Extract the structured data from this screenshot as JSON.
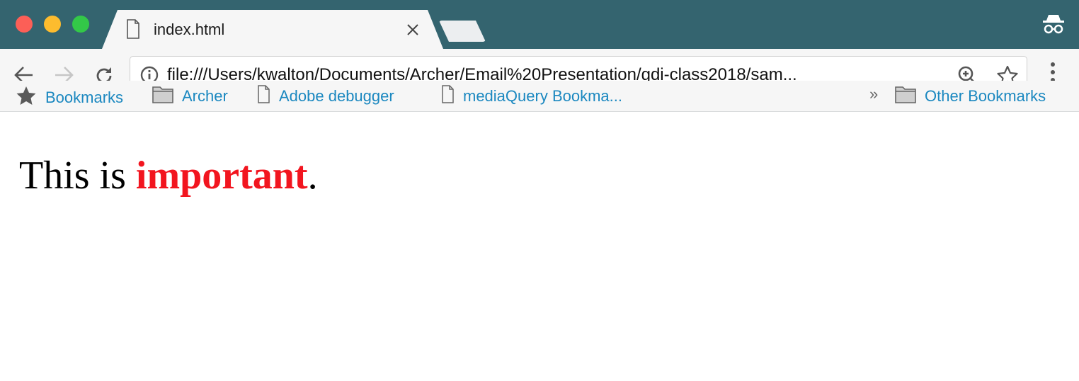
{
  "tab": {
    "title": "index.html"
  },
  "address_bar": {
    "url": "file:///Users/kwalton/Documents/Archer/Email%20Presentation/gdi-class2018/sam..."
  },
  "bookmarks_bar": {
    "items": [
      {
        "label": "Bookmarks",
        "icon": "star-icon"
      },
      {
        "label": "Archer",
        "icon": "folder-icon"
      },
      {
        "label": "Adobe debugger",
        "icon": "page-icon"
      },
      {
        "label": "mediaQuery Bookma...",
        "icon": "page-icon"
      }
    ],
    "overflow": "»",
    "other": {
      "label": "Other Bookmarks",
      "icon": "folder-icon"
    }
  },
  "page": {
    "text_before": "This is ",
    "emphasis": "important",
    "text_after": "."
  },
  "colors": {
    "titlebar": "#34646f",
    "link": "#1b88c0",
    "important": "#f2151f"
  }
}
